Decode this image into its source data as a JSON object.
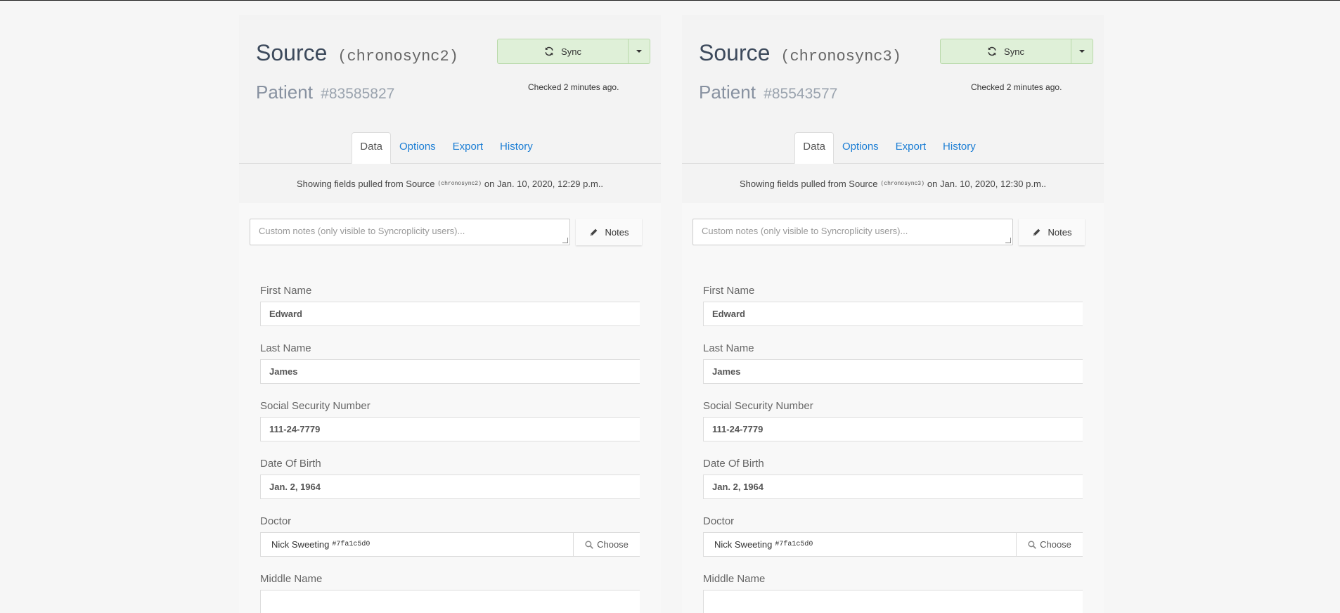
{
  "panels": [
    {
      "title": "Source",
      "source_id": "(chronosync2)",
      "subtitle": "Patient",
      "patient_id": "#83585827",
      "sync_label": "Sync",
      "checked": "Checked 2 minutes ago.",
      "tabs": [
        "Data",
        "Options",
        "Export",
        "History"
      ],
      "showing_prefix": "Showing fields pulled from Source",
      "showing_source": "(chronosync2)",
      "showing_suffix": "on Jan. 10, 2020, 12:29 p.m..",
      "notes_placeholder": "Custom notes (only visible to Syncroplicity users)...",
      "notes_label": "Notes",
      "fields": {
        "first_name": {
          "label": "First Name",
          "value": "Edward"
        },
        "last_name": {
          "label": "Last Name",
          "value": "James"
        },
        "ssn": {
          "label": "Social Security Number",
          "value": "111-24-7779"
        },
        "dob": {
          "label": "Date Of Birth",
          "value": "Jan. 2, 1964"
        },
        "doctor": {
          "label": "Doctor",
          "value": "Nick Sweeting",
          "id": "#7fa1c5d0",
          "choose": "Choose"
        },
        "middle_name": {
          "label": "Middle Name",
          "value": ""
        }
      }
    },
    {
      "title": "Source",
      "source_id": "(chronosync3)",
      "subtitle": "Patient",
      "patient_id": "#85543577",
      "sync_label": "Sync",
      "checked": "Checked 2 minutes ago.",
      "tabs": [
        "Data",
        "Options",
        "Export",
        "History"
      ],
      "showing_prefix": "Showing fields pulled from Source",
      "showing_source": "(chronosync3)",
      "showing_suffix": "on Jan. 10, 2020, 12:30 p.m..",
      "notes_placeholder": "Custom notes (only visible to Syncroplicity users)...",
      "notes_label": "Notes",
      "fields": {
        "first_name": {
          "label": "First Name",
          "value": "Edward"
        },
        "last_name": {
          "label": "Last Name",
          "value": "James"
        },
        "ssn": {
          "label": "Social Security Number",
          "value": "111-24-7779"
        },
        "dob": {
          "label": "Date Of Birth",
          "value": "Jan. 2, 1964"
        },
        "doctor": {
          "label": "Doctor",
          "value": "Nick Sweeting",
          "id": "#7fa1c5d0",
          "choose": "Choose"
        },
        "middle_name": {
          "label": "Middle Name",
          "value": ""
        }
      }
    }
  ],
  "colors": {
    "sync_bg": "#dff0d8",
    "tab_link": "#1a7dd4",
    "title": "#3d4a5c"
  },
  "icons": [
    "sync-icon",
    "chevron-down-icon",
    "pencil-icon",
    "search-icon"
  ]
}
